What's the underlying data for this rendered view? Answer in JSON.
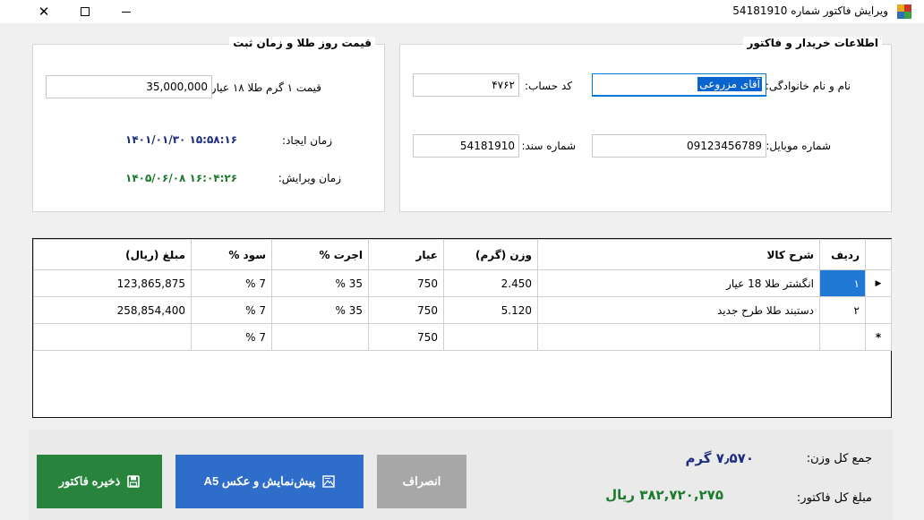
{
  "window": {
    "title": "ویرایش فاکتور شماره 54181910",
    "close_glyph": "✕"
  },
  "buyer_group": {
    "title": "اطلاعات خریدار و فاکتور",
    "name_label": "نام و نام خانوادگی:",
    "name_value": "آقای مزروعی",
    "account_label": "کد حساب:",
    "account_value": "۴۷۶۲",
    "mobile_label": "شماره موبایل:",
    "mobile_value": "09123456789",
    "doc_label": "شماره سند:",
    "doc_value": "54181910"
  },
  "gold_group": {
    "title": "قیمت روز طلا و زمان ثبت",
    "price_label": "قیمت ۱ گرم طلا ۱۸ عیار:",
    "price_value": "35,000,000",
    "created_label": "زمان ایجاد:",
    "created_value": "۱۴۰۱/۰۱/۳۰ ۱۵:۵۸:۱۶",
    "edited_label": "زمان ویرایش:",
    "edited_value": "۱۴۰۵/۰۶/۰۸ ۱۶:۰۴:۲۶"
  },
  "grid": {
    "columns": [
      "ردیف",
      "شرح کالا",
      "وزن (گرم)",
      "عیار",
      "اجرت %",
      "سود %",
      "مبلغ (ریال)"
    ],
    "current_row_glyph": "▶",
    "new_row_glyph": "*",
    "rows": [
      {
        "row": "۱",
        "desc": "انگشتر طلا 18 عیار",
        "weight": "2.450",
        "karat": "750",
        "wage": "35 %",
        "profit": "7 %",
        "amount": "123,865,875"
      },
      {
        "row": "۲",
        "desc": "دستبند طلا طرح جدید",
        "weight": "5.120",
        "karat": "750",
        "wage": "35 %",
        "profit": "7 %",
        "amount": "258,854,400"
      },
      {
        "row": "",
        "desc": "",
        "weight": "",
        "karat": "750",
        "wage": "",
        "profit": "7 %",
        "amount": ""
      }
    ]
  },
  "summary": {
    "weight_label": "جمع کل وزن:",
    "weight_value": "۷٫۵۷۰ گرم",
    "total_label": "مبلغ کل فاکتور:",
    "total_value": "۳۸۲,۷۲۰,۲۷۵ ریال"
  },
  "buttons": {
    "save": "ذخیره فاکتور",
    "preview": "پیش‌نمایش و عکس A5",
    "cancel": "انصراف"
  },
  "colors": {
    "save": "#28843c",
    "preview": "#2e6dc9",
    "cancel": "#a7a7a7",
    "selection": "#1f78d4"
  }
}
